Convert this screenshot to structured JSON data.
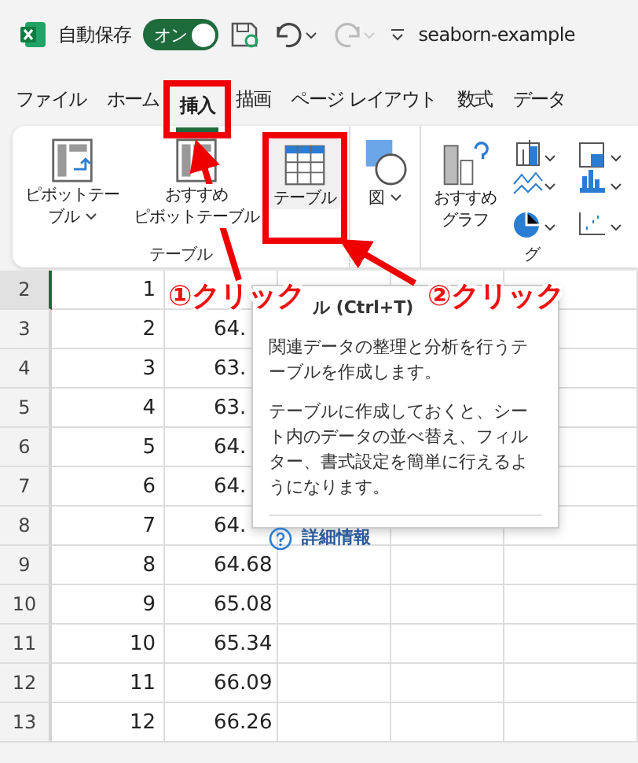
{
  "title_bar": {
    "autosave_label": "自動保存",
    "autosave": {
      "label": "オン",
      "on": true
    },
    "redo_disabled": true,
    "filename": "seaborn-example"
  },
  "tabs": [
    {
      "label": "ファイル",
      "selected": false,
      "highlighted": false
    },
    {
      "label": "ホーム",
      "selected": false,
      "highlighted": false
    },
    {
      "label": "挿入",
      "selected": true,
      "highlighted": true
    },
    {
      "label": "描画",
      "selected": false,
      "highlighted": false
    },
    {
      "label": "ページ レイアウト",
      "selected": false,
      "highlighted": false
    },
    {
      "label": "数式",
      "selected": false,
      "highlighted": false
    },
    {
      "label": "データ",
      "selected": false,
      "highlighted": false
    }
  ],
  "ribbon": {
    "groups": [
      {
        "label": "テーブル",
        "buttons": [
          {
            "kind": "pivot",
            "lines": [
              "ピボットテー",
              "ブル"
            ],
            "dropdown": true,
            "highlighted": false
          },
          {
            "kind": "recommended_pivot",
            "lines": [
              "おすすめ",
              "ピボットテーブル"
            ],
            "dropdown": false,
            "highlighted": false
          },
          {
            "kind": "table",
            "lines": [
              "テーブル"
            ],
            "dropdown": false,
            "highlighted": true
          }
        ]
      },
      {
        "buttons": [
          {
            "kind": "shapes",
            "lines": [
              "図"
            ],
            "dropdown": true,
            "highlighted": false
          }
        ]
      },
      {
        "label": "グ",
        "buttons": [
          {
            "kind": "recommended_chart",
            "lines": [
              "おすすめ",
              "グラフ"
            ],
            "dropdown": false,
            "highlighted": false
          },
          {
            "kind": "chart_grid",
            "highlighted": false
          }
        ]
      }
    ]
  },
  "sheet": {
    "rows": [
      {
        "number": "2",
        "a": "1",
        "b": "",
        "active": true
      },
      {
        "number": "3",
        "a": "2",
        "b": "64.",
        "active": false
      },
      {
        "number": "4",
        "a": "3",
        "b": "63.",
        "active": false
      },
      {
        "number": "5",
        "a": "4",
        "b": "63.",
        "active": false
      },
      {
        "number": "6",
        "a": "5",
        "b": "64.",
        "active": false
      },
      {
        "number": "7",
        "a": "6",
        "b": "64.",
        "active": false
      },
      {
        "number": "8",
        "a": "7",
        "b": "64.",
        "active": false
      },
      {
        "number": "9",
        "a": "8",
        "b": "64.68",
        "active": false
      },
      {
        "number": "10",
        "a": "9",
        "b": "65.08",
        "active": false
      },
      {
        "number": "11",
        "a": "10",
        "b": "65.34",
        "active": false
      },
      {
        "number": "12",
        "a": "11",
        "b": "66.09",
        "active": false
      },
      {
        "number": "13",
        "a": "12",
        "b": "66.26",
        "active": false
      }
    ]
  },
  "tooltip": {
    "title": "ル (Ctrl+T)",
    "paragraphs": [
      "関連データの整理と分析を行うテーブルを作成します。",
      "テーブルに作成しておくと、シート内のデータの並べ替え、フィルター、書式設定を簡単に行えるようになります。"
    ],
    "link": "詳細情報"
  },
  "annotations": [
    {
      "label": "①クリック"
    },
    {
      "label": "②クリック"
    }
  ]
}
